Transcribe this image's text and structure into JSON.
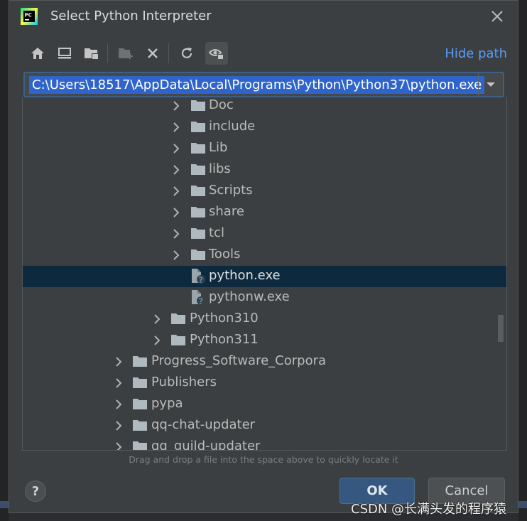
{
  "dialog": {
    "title": "Select Python Interpreter",
    "app_icon_text": "PC",
    "hide_path_label": "Hide path",
    "path_value": "C:\\Users\\18517\\AppData\\Local\\Programs\\Python\\Python37\\python.exe",
    "hint": "Drag and drop a file into the space above to quickly locate it",
    "ok_label": "OK",
    "cancel_label": "Cancel",
    "help_label": "?"
  },
  "toolbar": [
    {
      "name": "home-icon"
    },
    {
      "name": "desktop-icon"
    },
    {
      "name": "project-folder-icon"
    },
    {
      "name": "new-folder-icon"
    },
    {
      "name": "delete-icon"
    },
    {
      "name": "refresh-icon"
    },
    {
      "name": "show-hidden-icon"
    }
  ],
  "tree": {
    "rows": [
      {
        "label": "Doc",
        "type": "folder",
        "level": 2,
        "expandable": true
      },
      {
        "label": "include",
        "type": "folder",
        "level": 2,
        "expandable": true
      },
      {
        "label": "Lib",
        "type": "folder",
        "level": 2,
        "expandable": true
      },
      {
        "label": "libs",
        "type": "folder",
        "level": 2,
        "expandable": true
      },
      {
        "label": "Scripts",
        "type": "folder",
        "level": 2,
        "expandable": true
      },
      {
        "label": "share",
        "type": "folder",
        "level": 2,
        "expandable": true
      },
      {
        "label": "tcl",
        "type": "folder",
        "level": 2,
        "expandable": true
      },
      {
        "label": "Tools",
        "type": "folder",
        "level": 2,
        "expandable": true
      },
      {
        "label": "python.exe",
        "type": "file",
        "level": 2,
        "expandable": false,
        "selected": true
      },
      {
        "label": "pythonw.exe",
        "type": "file",
        "level": 2,
        "expandable": false
      },
      {
        "label": "Python310",
        "type": "folder",
        "level": 1,
        "expandable": true
      },
      {
        "label": "Python311",
        "type": "folder",
        "level": 1,
        "expandable": true
      },
      {
        "label": "Progress_Software_Corpora",
        "type": "folder",
        "level": 0,
        "expandable": true
      },
      {
        "label": "Publishers",
        "type": "folder",
        "level": 0,
        "expandable": true
      },
      {
        "label": "pypa",
        "type": "folder",
        "level": 0,
        "expandable": true
      },
      {
        "label": "qq-chat-updater",
        "type": "folder",
        "level": 0,
        "expandable": true
      },
      {
        "label": "qq_guild-updater",
        "type": "folder",
        "level": 0,
        "expandable": true
      }
    ]
  },
  "watermark": "CSDN @长满头发的程序猿",
  "colors": {
    "accent": "#589df6",
    "selection": "#0d293e",
    "path_selection": "#2f65ca",
    "ok_button": "#365880"
  }
}
